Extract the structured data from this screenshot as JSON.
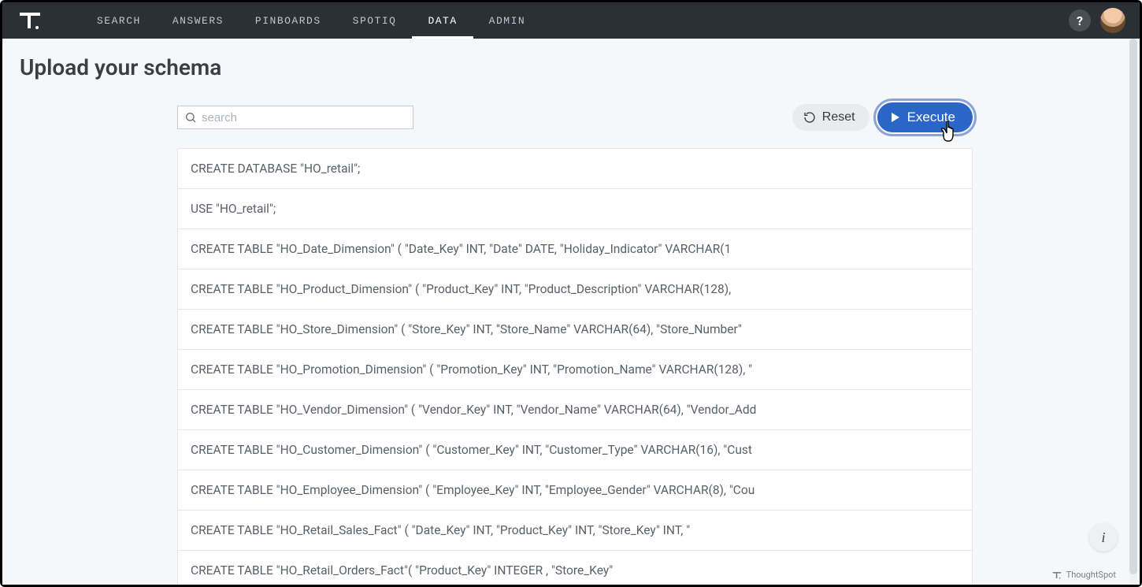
{
  "nav": {
    "items": [
      {
        "label": "SEARCH",
        "active": false
      },
      {
        "label": "ANSWERS",
        "active": false
      },
      {
        "label": "PINBOARDS",
        "active": false
      },
      {
        "label": "SPOTIQ",
        "active": false
      },
      {
        "label": "DATA",
        "active": true
      },
      {
        "label": "ADMIN",
        "active": false
      }
    ]
  },
  "page": {
    "title": "Upload your schema"
  },
  "search": {
    "placeholder": "search",
    "value": ""
  },
  "toolbar": {
    "reset_label": "Reset",
    "execute_label": "Execute"
  },
  "sql_rows": [
    "CREATE DATABASE \"HO_retail\";",
    "USE \"HO_retail\";",
    "CREATE TABLE \"HO_Date_Dimension\" ( \"Date_Key\" INT, \"Date\" DATE, \"Holiday_Indicator\" VARCHAR(1",
    "CREATE TABLE \"HO_Product_Dimension\" ( \"Product_Key\" INT, \"Product_Description\" VARCHAR(128),",
    "CREATE TABLE \"HO_Store_Dimension\" ( \"Store_Key\" INT, \"Store_Name\" VARCHAR(64), \"Store_Number\"",
    "CREATE TABLE \"HO_Promotion_Dimension\" ( \"Promotion_Key\" INT, \"Promotion_Name\" VARCHAR(128), \"",
    "CREATE TABLE \"HO_Vendor_Dimension\" ( \"Vendor_Key\" INT, \"Vendor_Name\" VARCHAR(64), \"Vendor_Add",
    "CREATE TABLE \"HO_Customer_Dimension\" ( \"Customer_Key\" INT, \"Customer_Type\" VARCHAR(16), \"Cust",
    "CREATE TABLE \"HO_Employee_Dimension\" ( \"Employee_Key\" INT, \"Employee_Gender\" VARCHAR(8), \"Cou",
    "CREATE TABLE \"HO_Retail_Sales_Fact\" ( \"Date_Key\" INT, \"Product_Key\" INT, \"Store_Key\" INT, \"",
    "CREATE TABLE \"HO_Retail_Orders_Fact\"( \"Product_Key\" INTEGER , \"Store_Key\""
  ],
  "footer": {
    "brand": "ThoughtSpot"
  }
}
